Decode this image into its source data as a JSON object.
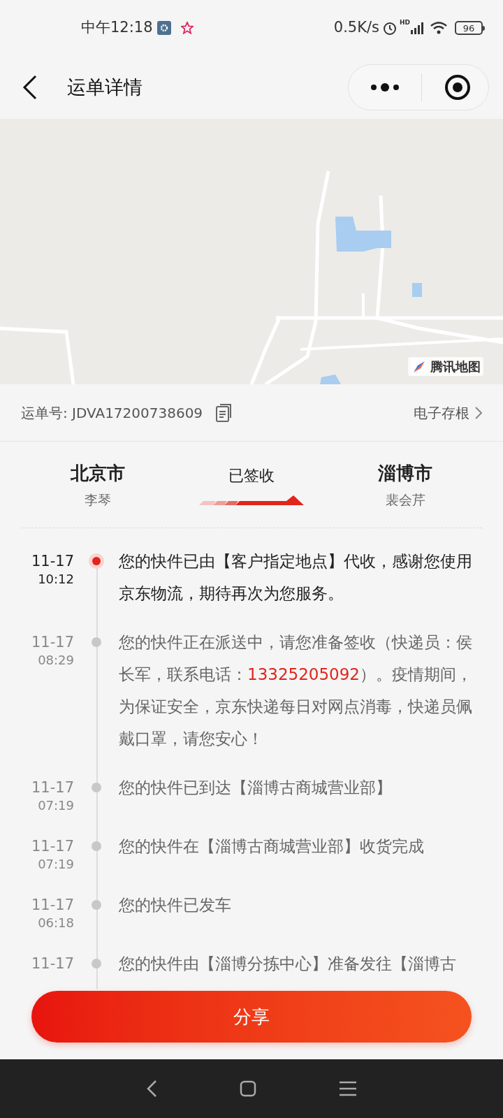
{
  "status_bar": {
    "time": "中午12:18",
    "speed": "0.5K/s",
    "network": "HD",
    "battery": "96"
  },
  "header": {
    "title": "运单详情"
  },
  "map": {
    "attribution": "腾讯地图"
  },
  "waybill": {
    "label": "运单号: JDVA17200738609",
    "archive_link": "电子存根"
  },
  "route": {
    "from_city": "北京市",
    "from_name": "李琴",
    "status": "已签收",
    "to_city": "淄博市",
    "to_name": "裴会芹"
  },
  "events": [
    {
      "date": "11-17",
      "time": "10:12",
      "current": true,
      "segments": [
        {
          "kind": "plain",
          "text": "您的快件已由【客户指定地点】代收，感谢您使用京东物流，期待再次为您服务。"
        }
      ]
    },
    {
      "date": "11-17",
      "time": "08:29",
      "current": false,
      "segments": [
        {
          "kind": "plain",
          "text": "您的快件正在派送中，请您准备签收（快递员：侯长军，联系电话："
        },
        {
          "kind": "phone",
          "text": "13325205092"
        },
        {
          "kind": "plain",
          "text": "）。疫情期间，为保证安全，京东快递每日对网点消毒，快递员佩戴口罩，请您安心！"
        }
      ]
    },
    {
      "date": "11-17",
      "time": "07:19",
      "current": false,
      "segments": [
        {
          "kind": "plain",
          "text": "您的快件已到达【淄博古商城营业部】"
        }
      ]
    },
    {
      "date": "11-17",
      "time": "07:19",
      "current": false,
      "segments": [
        {
          "kind": "plain",
          "text": "您的快件在【淄博古商城营业部】收货完成"
        }
      ]
    },
    {
      "date": "11-17",
      "time": "06:18",
      "current": false,
      "segments": [
        {
          "kind": "plain",
          "text": "您的快件已发车"
        }
      ]
    },
    {
      "date": "11-17",
      "current": false,
      "segments": [
        {
          "kind": "plain",
          "text": "您的快件由【淄博分拣中心】准备发往【淄博古"
        }
      ]
    }
  ],
  "share_button": {
    "label": "分享"
  }
}
